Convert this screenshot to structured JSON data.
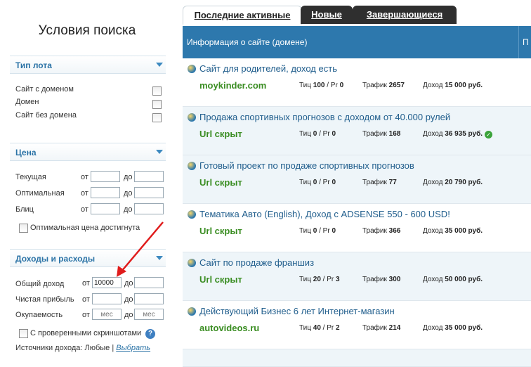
{
  "sidebar": {
    "title": "Условия поиска",
    "lot_type": {
      "header": "Тип лота",
      "options": [
        "Сайт с доменом",
        "Домен",
        "Сайт без домена"
      ]
    },
    "price": {
      "header": "Цена",
      "rows": [
        {
          "label": "Текущая",
          "from": "от",
          "to": "до"
        },
        {
          "label": "Оптимальная",
          "from": "от",
          "to": "до"
        },
        {
          "label": "Блиц",
          "from": "от",
          "to": "до"
        }
      ],
      "optimal_reached": "Оптимальная цена достигнута"
    },
    "income": {
      "header": "Доходы и расходы",
      "rows": [
        {
          "label": "Общий доход",
          "from": "от",
          "to": "до",
          "from_value": "10000"
        },
        {
          "label": "Чистая прибыль",
          "from": "от",
          "to": "до"
        },
        {
          "label": "Окупаемость",
          "from": "от",
          "to": "до",
          "from_placeholder": "мес",
          "to_placeholder": "мес"
        }
      ],
      "verified_screens": "С проверенными скриншотами",
      "help": "?",
      "sources_label": "Источники дохода: Любые |",
      "sources_link": "Выбрать"
    }
  },
  "tabs": [
    "Последние активные",
    "Новые",
    "Завершающиеся"
  ],
  "table_header": {
    "info": "Информация о сайте (домене)",
    "next": "П"
  },
  "listings": [
    {
      "title": "Сайт для родителей, доход есть",
      "domain": "moykinder.com",
      "tic_label": "Тиц",
      "tic": "100",
      "pr_label": "Pr",
      "pr": "0",
      "traffic_label": "Трафик",
      "traffic": "2657",
      "income_label": "Доход",
      "income": "15 000 руб.",
      "verified": false
    },
    {
      "title": "Продажа спортивных прогнозов с доходом от 40.000 рулей",
      "domain": "Url скрыт",
      "tic_label": "Тиц",
      "tic": "0",
      "pr_label": "Pr",
      "pr": "0",
      "traffic_label": "Трафик",
      "traffic": "168",
      "income_label": "Доход",
      "income": "36 935 руб.",
      "verified": true
    },
    {
      "title": "Готовый проект по продаже спортивных прогнозов",
      "domain": "Url скрыт",
      "tic_label": "Тиц",
      "tic": "0",
      "pr_label": "Pr",
      "pr": "0",
      "traffic_label": "Трафик",
      "traffic": "77",
      "income_label": "Доход",
      "income": "20 790 руб.",
      "verified": false
    },
    {
      "title": "Тематика Авто (English), Доход с ADSENSE 550 - 600 USD!",
      "domain": "Url скрыт",
      "tic_label": "Тиц",
      "tic": "0",
      "pr_label": "Pr",
      "pr": "0",
      "traffic_label": "Трафик",
      "traffic": "366",
      "income_label": "Доход",
      "income": "35 000 руб.",
      "verified": false
    },
    {
      "title": "Сайт по продаже франшиз",
      "domain": "Url скрыт",
      "tic_label": "Тиц",
      "tic": "20",
      "pr_label": "Pr",
      "pr": "3",
      "traffic_label": "Трафик",
      "traffic": "300",
      "income_label": "Доход",
      "income": "50 000 руб.",
      "verified": false
    },
    {
      "title": "Действующий Бизнес 6 лет Интернет-магазин",
      "domain": "autovideos.ru",
      "tic_label": "Тиц",
      "tic": "40",
      "pr_label": "Pr",
      "pr": "2",
      "traffic_label": "Трафик",
      "traffic": "214",
      "income_label": "Доход",
      "income": "35 000 руб.",
      "verified": false
    }
  ],
  "colors": {
    "header_bg": "#2d78ad",
    "title_link": "#1f5d8c",
    "domain_green": "#3a8d22",
    "arrow_red": "#e01c1c"
  }
}
